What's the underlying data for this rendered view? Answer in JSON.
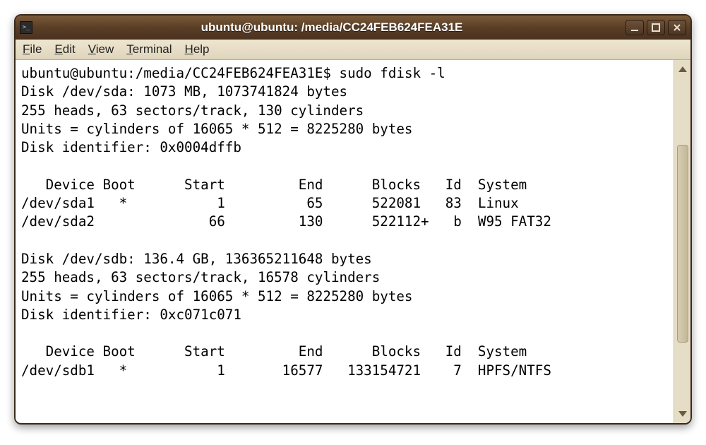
{
  "window": {
    "title": "ubuntu@ubuntu: /media/CC24FEB624FEA31E"
  },
  "menu": {
    "file": "File",
    "edit": "Edit",
    "view": "View",
    "terminal": "Terminal",
    "help": "Help"
  },
  "terminal": {
    "prompt": "ubuntu@ubuntu:/media/CC24FEB624FEA31E$ ",
    "command": "sudo fdisk -l",
    "output": "\nDisk /dev/sda: 1073 MB, 1073741824 bytes\n255 heads, 63 sectors/track, 130 cylinders\nUnits = cylinders of 16065 * 512 = 8225280 bytes\nDisk identifier: 0x0004dffb\n\n   Device Boot      Start         End      Blocks   Id  System\n/dev/sda1   *           1          65      522081   83  Linux\n/dev/sda2              66         130      522112+   b  W95 FAT32\n\nDisk /dev/sdb: 136.4 GB, 136365211648 bytes\n255 heads, 63 sectors/track, 16578 cylinders\nUnits = cylinders of 16065 * 512 = 8225280 bytes\nDisk identifier: 0xc071c071\n\n   Device Boot      Start         End      Blocks   Id  System\n/dev/sdb1   *           1       16577   133154721    7  HPFS/NTFS"
  }
}
